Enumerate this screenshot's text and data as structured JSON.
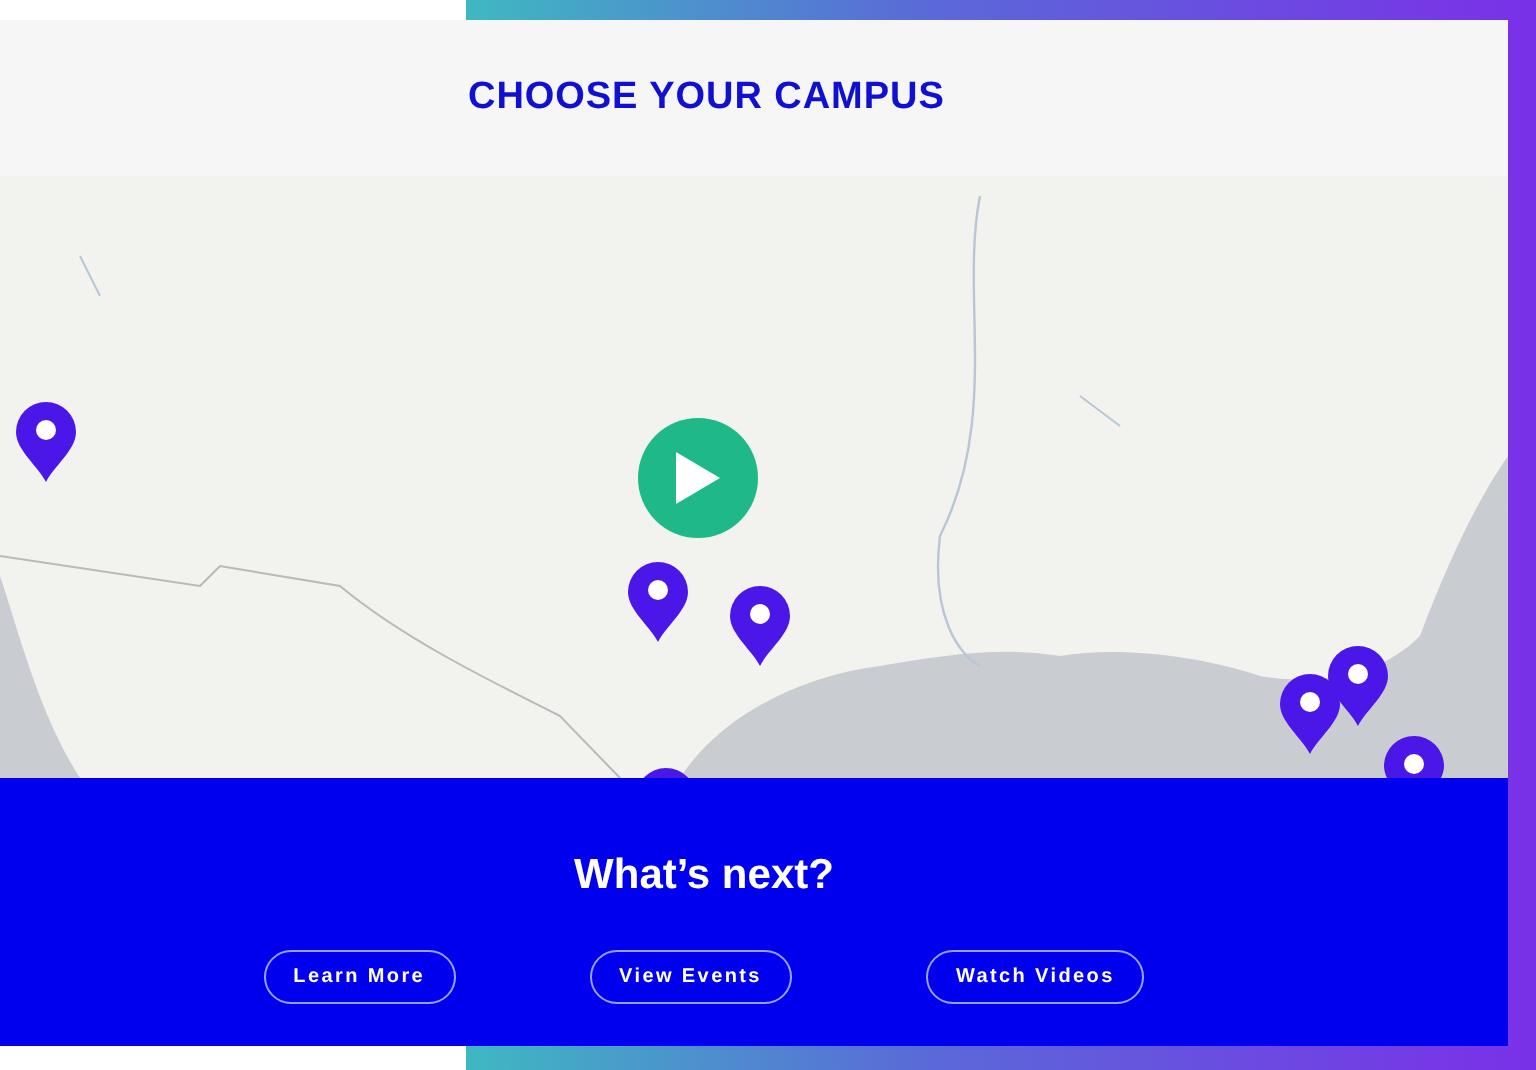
{
  "header": {
    "title": "CHOOSE YOUR CAMPUS"
  },
  "next_section": {
    "heading": "What’s next?",
    "buttons": [
      "Learn More",
      "View Events",
      "Watch Videos"
    ]
  }
}
